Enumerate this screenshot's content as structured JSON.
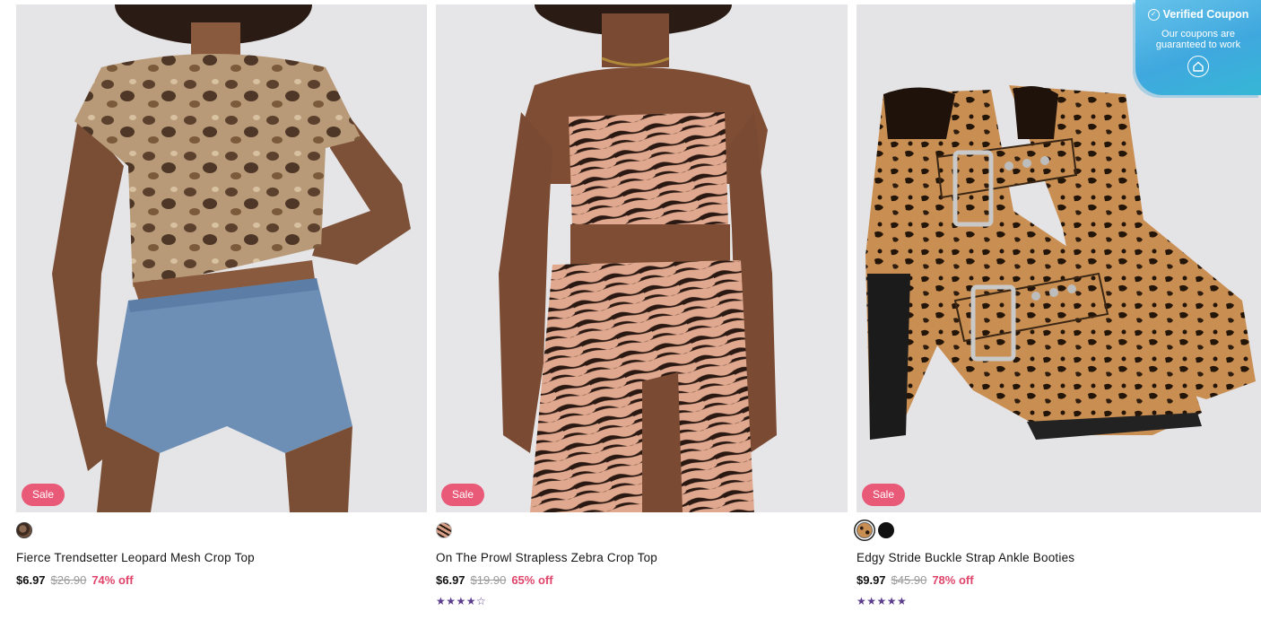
{
  "products": [
    {
      "name": "Fierce Trendsetter Leopard Mesh Crop Top",
      "badge": "Sale",
      "price": "$6.97",
      "original_price": "$26.90",
      "discount": "74% off",
      "rating": "",
      "swatches": [
        "leopard-dark"
      ]
    },
    {
      "name": "On The Prowl Strapless Zebra Crop Top",
      "badge": "Sale",
      "price": "$6.97",
      "original_price": "$19.90",
      "discount": "65% off",
      "rating": "★★★★☆",
      "rating_value": 4,
      "swatches": [
        "zebra"
      ]
    },
    {
      "name": "Edgy Stride Buckle Strap Ankle Booties",
      "badge": "Sale",
      "price": "$9.97",
      "original_price": "$45.90",
      "discount": "78% off",
      "rating": "★★★★★",
      "rating_value": 5,
      "swatches": [
        "leopard",
        "black"
      ],
      "selected_swatch": "leopard"
    }
  ],
  "coupon_widget": {
    "title": "Verified Coupon",
    "subtitle": "Our coupons are guaranteed to work",
    "icon": "check-circle-icon"
  },
  "colors": {
    "sale_badge": "#e85a78",
    "discount_text": "#e0446a",
    "rating_stars": "#5b3c8c",
    "coupon_accent": "#3fa8de"
  }
}
